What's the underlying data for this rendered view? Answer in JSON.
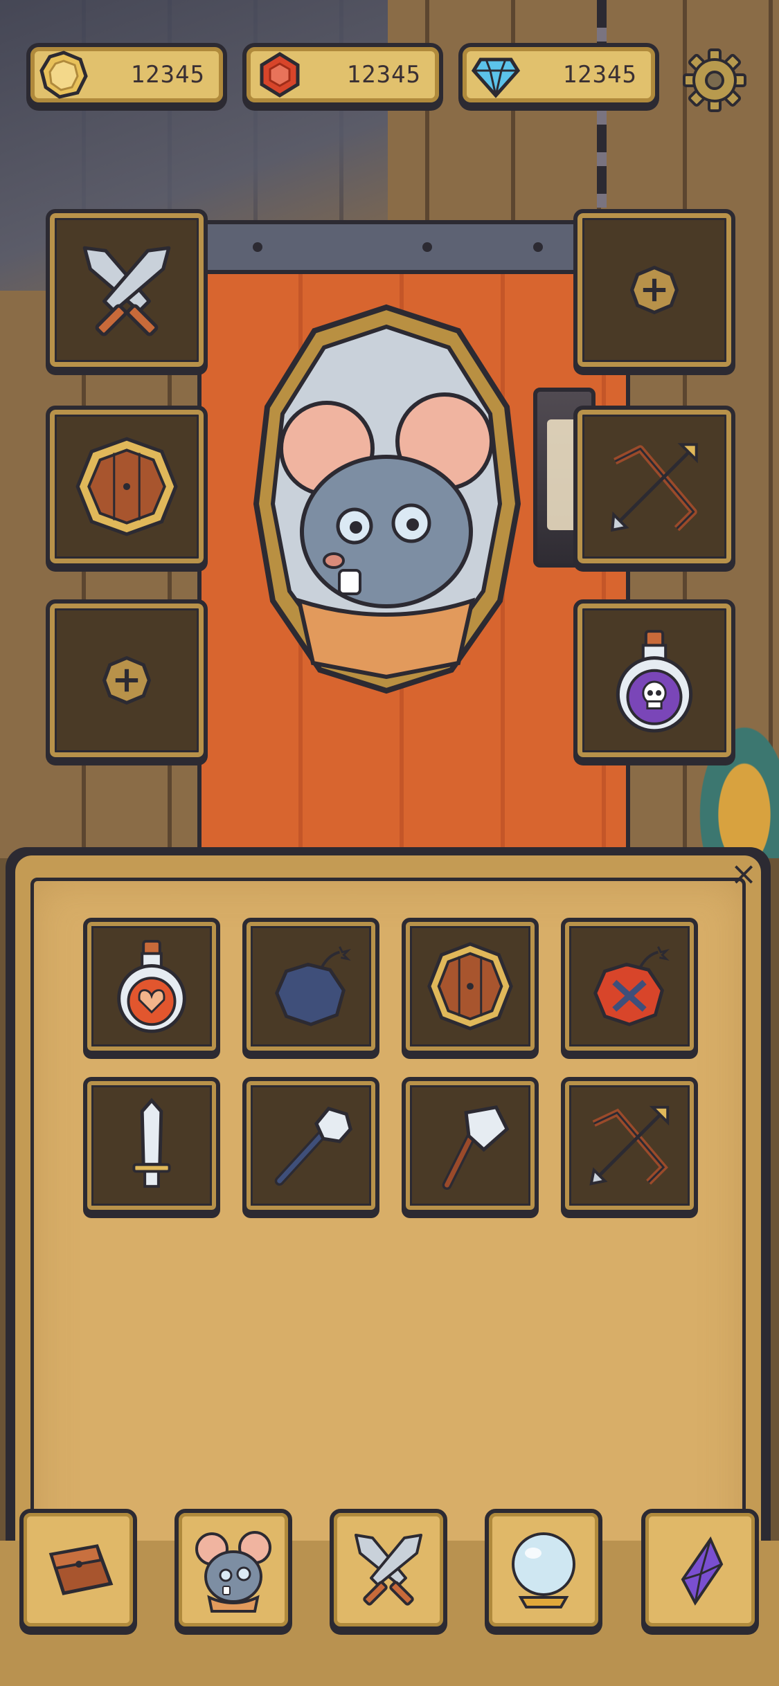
{
  "currencies": [
    {
      "id": "gold",
      "icon": "gold-coin-icon",
      "amount": "12345",
      "color": "#e8c15a"
    },
    {
      "id": "ruby",
      "icon": "red-gem-icon",
      "amount": "12345",
      "color": "#d8452a"
    },
    {
      "id": "diamond",
      "icon": "blue-diamond-icon",
      "amount": "12345",
      "color": "#5cc3ea"
    }
  ],
  "settings": {
    "icon": "gear-icon"
  },
  "equipment": {
    "left": [
      {
        "slot": "weapon",
        "item": "crossed-swords-icon"
      },
      {
        "slot": "shield",
        "item": "wooden-shield-icon"
      },
      {
        "slot": "empty",
        "item": "add-icon"
      }
    ],
    "right": [
      {
        "slot": "empty",
        "item": "add-icon"
      },
      {
        "slot": "ranged",
        "item": "crossbow-icon"
      },
      {
        "slot": "consumable",
        "item": "poison-potion-icon"
      }
    ]
  },
  "character": {
    "icon": "mouse-hero-portrait"
  },
  "inventory": {
    "close_icon": "close-icon",
    "close_label": "×",
    "items": [
      "health-potion-icon",
      "bomb-icon",
      "wooden-shield-icon",
      "red-bomb-icon",
      "sword-icon",
      "mace-icon",
      "axe-icon",
      "crossbow-icon"
    ]
  },
  "nav": [
    {
      "id": "bag",
      "icon": "bag-icon"
    },
    {
      "id": "hero",
      "icon": "mouse-portrait-icon"
    },
    {
      "id": "battle",
      "icon": "crossed-swords-icon"
    },
    {
      "id": "orb",
      "icon": "crystal-ball-icon"
    },
    {
      "id": "crystal",
      "icon": "purple-crystal-icon"
    }
  ],
  "colors": {
    "ink": "#2c2a32",
    "frame": "#e1c16d",
    "slot_bg": "#4a3a26",
    "door": "#d8652f",
    "panel": "#d8ae68"
  }
}
